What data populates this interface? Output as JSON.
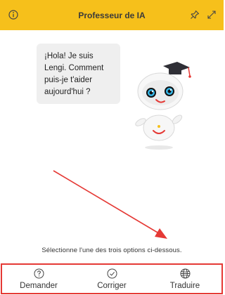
{
  "header": {
    "title": "Professeur de IA",
    "bg_color": "#f6c01b"
  },
  "chat": {
    "message": "¡Hola! Je suis Lengi. Comment puis-je t'aider aujourd'hui ?"
  },
  "hint": "Sélectionne l'une des trois options ci-dessous.",
  "options": [
    {
      "label": "Demander",
      "icon": "question-icon"
    },
    {
      "label": "Corriger",
      "icon": "check-circle-icon"
    },
    {
      "label": "Traduire",
      "icon": "globe-icon"
    }
  ],
  "colors": {
    "accent": "#f6c01b",
    "highlight_border": "#e53935",
    "arrow": "#e53935"
  }
}
